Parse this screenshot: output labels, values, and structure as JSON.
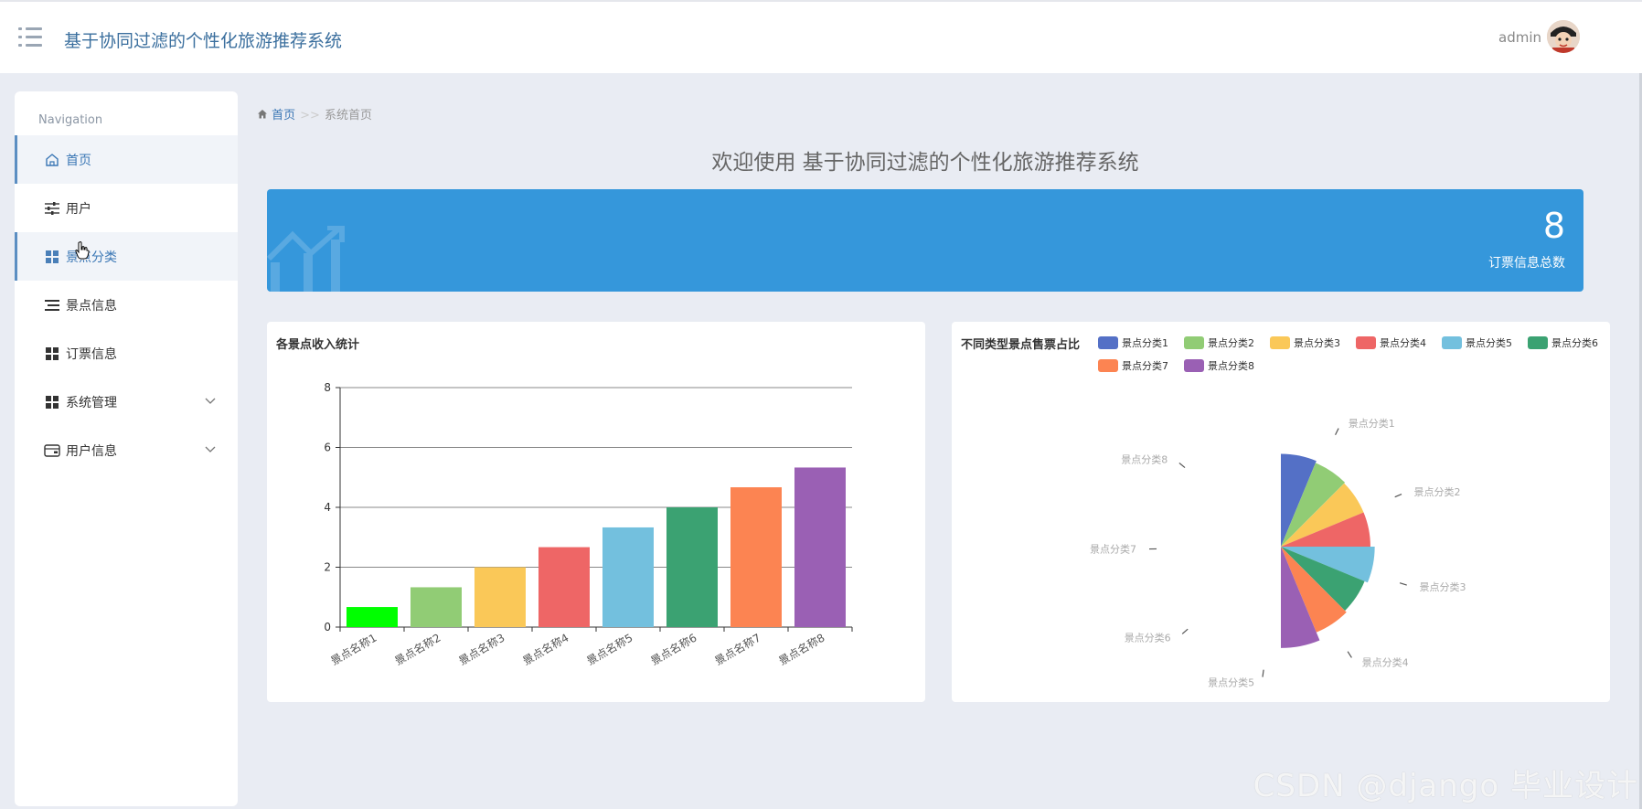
{
  "header": {
    "title": "基于协同过滤的个性化旅游推荐系统",
    "username": "admin"
  },
  "sidebar": {
    "heading": "Navigation",
    "items": [
      {
        "label": "首页",
        "icon": "home-icon"
      },
      {
        "label": "用户",
        "icon": "sliders-icon"
      },
      {
        "label": "景点分类",
        "icon": "grid-icon"
      },
      {
        "label": "景点信息",
        "icon": "list-icon"
      },
      {
        "label": "订票信息",
        "icon": "grid-icon"
      },
      {
        "label": "系统管理",
        "icon": "grid-icon",
        "expandable": true
      },
      {
        "label": "用户信息",
        "icon": "wallet-icon",
        "expandable": true
      }
    ]
  },
  "breadcrumb": {
    "home": "首页",
    "separator": ">>",
    "current": "系统首页"
  },
  "welcome": "欢迎使用 基于协同过滤的个性化旅游推荐系统",
  "stat": {
    "value": "8",
    "label": "订票信息总数",
    "color": "#3597db"
  },
  "watermark": "CSDN @django 毕业设计",
  "chart_data": [
    {
      "type": "bar",
      "title": "各景点收入统计",
      "categories": [
        "景点名称1",
        "景点名称2",
        "景点名称3",
        "景点名称4",
        "景点名称5",
        "景点名称6",
        "景点名称7",
        "景点名称8"
      ],
      "values": [
        0.67,
        1.33,
        2.0,
        2.67,
        3.33,
        4.0,
        4.67,
        5.33
      ],
      "colors": [
        "#00ff00",
        "#91cc75",
        "#fac858",
        "#ee6666",
        "#73c0de",
        "#3ba272",
        "#fc8452",
        "#9a60b4"
      ],
      "ylim": [
        0,
        8
      ],
      "yticks": [
        0,
        2,
        4,
        6,
        8
      ],
      "grid": true
    },
    {
      "type": "pie",
      "title": "不同类型景点售票占比",
      "rose": true,
      "legend": [
        "景点分类1",
        "景点分类2",
        "景点分类3",
        "景点分类4",
        "景点分类5",
        "景点分类6",
        "景点分类7",
        "景点分类8"
      ],
      "legend_position": "top-right",
      "values": [
        1,
        1,
        1,
        1,
        1,
        1,
        1,
        1
      ],
      "radii": [
        0.86,
        0.84,
        0.83,
        0.83,
        0.87,
        0.84,
        0.86,
        0.94
      ],
      "colors": [
        "#5470c6",
        "#91cc75",
        "#fac858",
        "#ee6666",
        "#73c0de",
        "#3ba272",
        "#fc8452",
        "#9a60b4"
      ],
      "slice_labels": [
        "景点分类1",
        "景点分类2",
        "景点分类3",
        "景点分类4",
        "景点分类5",
        "景点分类6",
        "景点分类7",
        "景点分类8"
      ]
    }
  ]
}
